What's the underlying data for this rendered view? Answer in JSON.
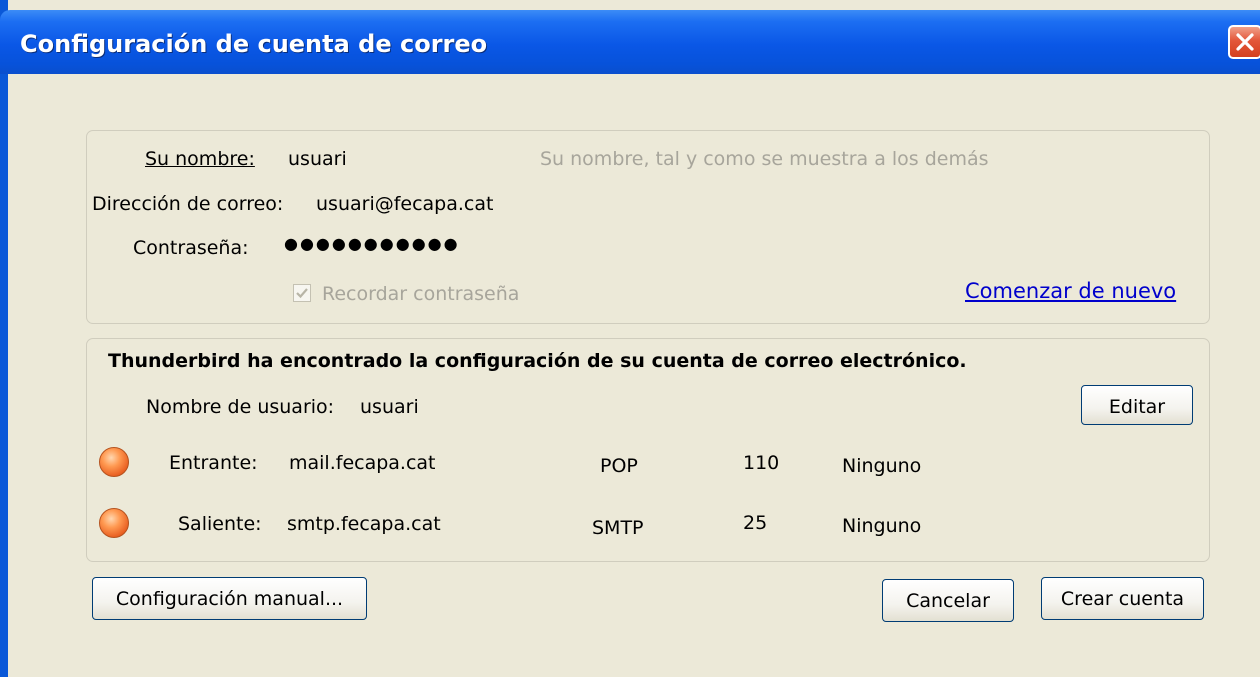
{
  "window": {
    "title": "Configuración de cuenta de correo",
    "close_label": "close"
  },
  "form": {
    "name_label": "Su nombre:",
    "name_value": "usuari",
    "name_hint": "Su nombre, tal y como se muestra a los demás",
    "email_label": "Dirección de correo:",
    "email_value": "usuari@fecapa.cat",
    "password_label": "Contraseña:",
    "password_mask": "●●●●●●●●●●●",
    "remember_label": "Recordar contraseña",
    "remember_checked": true,
    "start_over_link": "Comenzar de nuevo"
  },
  "found": {
    "headline": "Thunderbird ha encontrado la configuración de su cuenta de correo electrónico.",
    "username_label": "Nombre de usuario:",
    "username_value": "usuari",
    "edit_button": "Editar",
    "incoming": {
      "label": "Entrante:",
      "server": "mail.fecapa.cat",
      "protocol": "POP",
      "port": "110",
      "security": "Ninguno"
    },
    "outgoing": {
      "label": "Saliente:",
      "server": "smtp.fecapa.cat",
      "protocol": "SMTP",
      "port": "25",
      "security": "Ninguno"
    },
    "status_color": "#f07a3a"
  },
  "buttons": {
    "manual": "Configuración manual...",
    "cancel": "Cancelar",
    "create": "Crear cuenta"
  }
}
